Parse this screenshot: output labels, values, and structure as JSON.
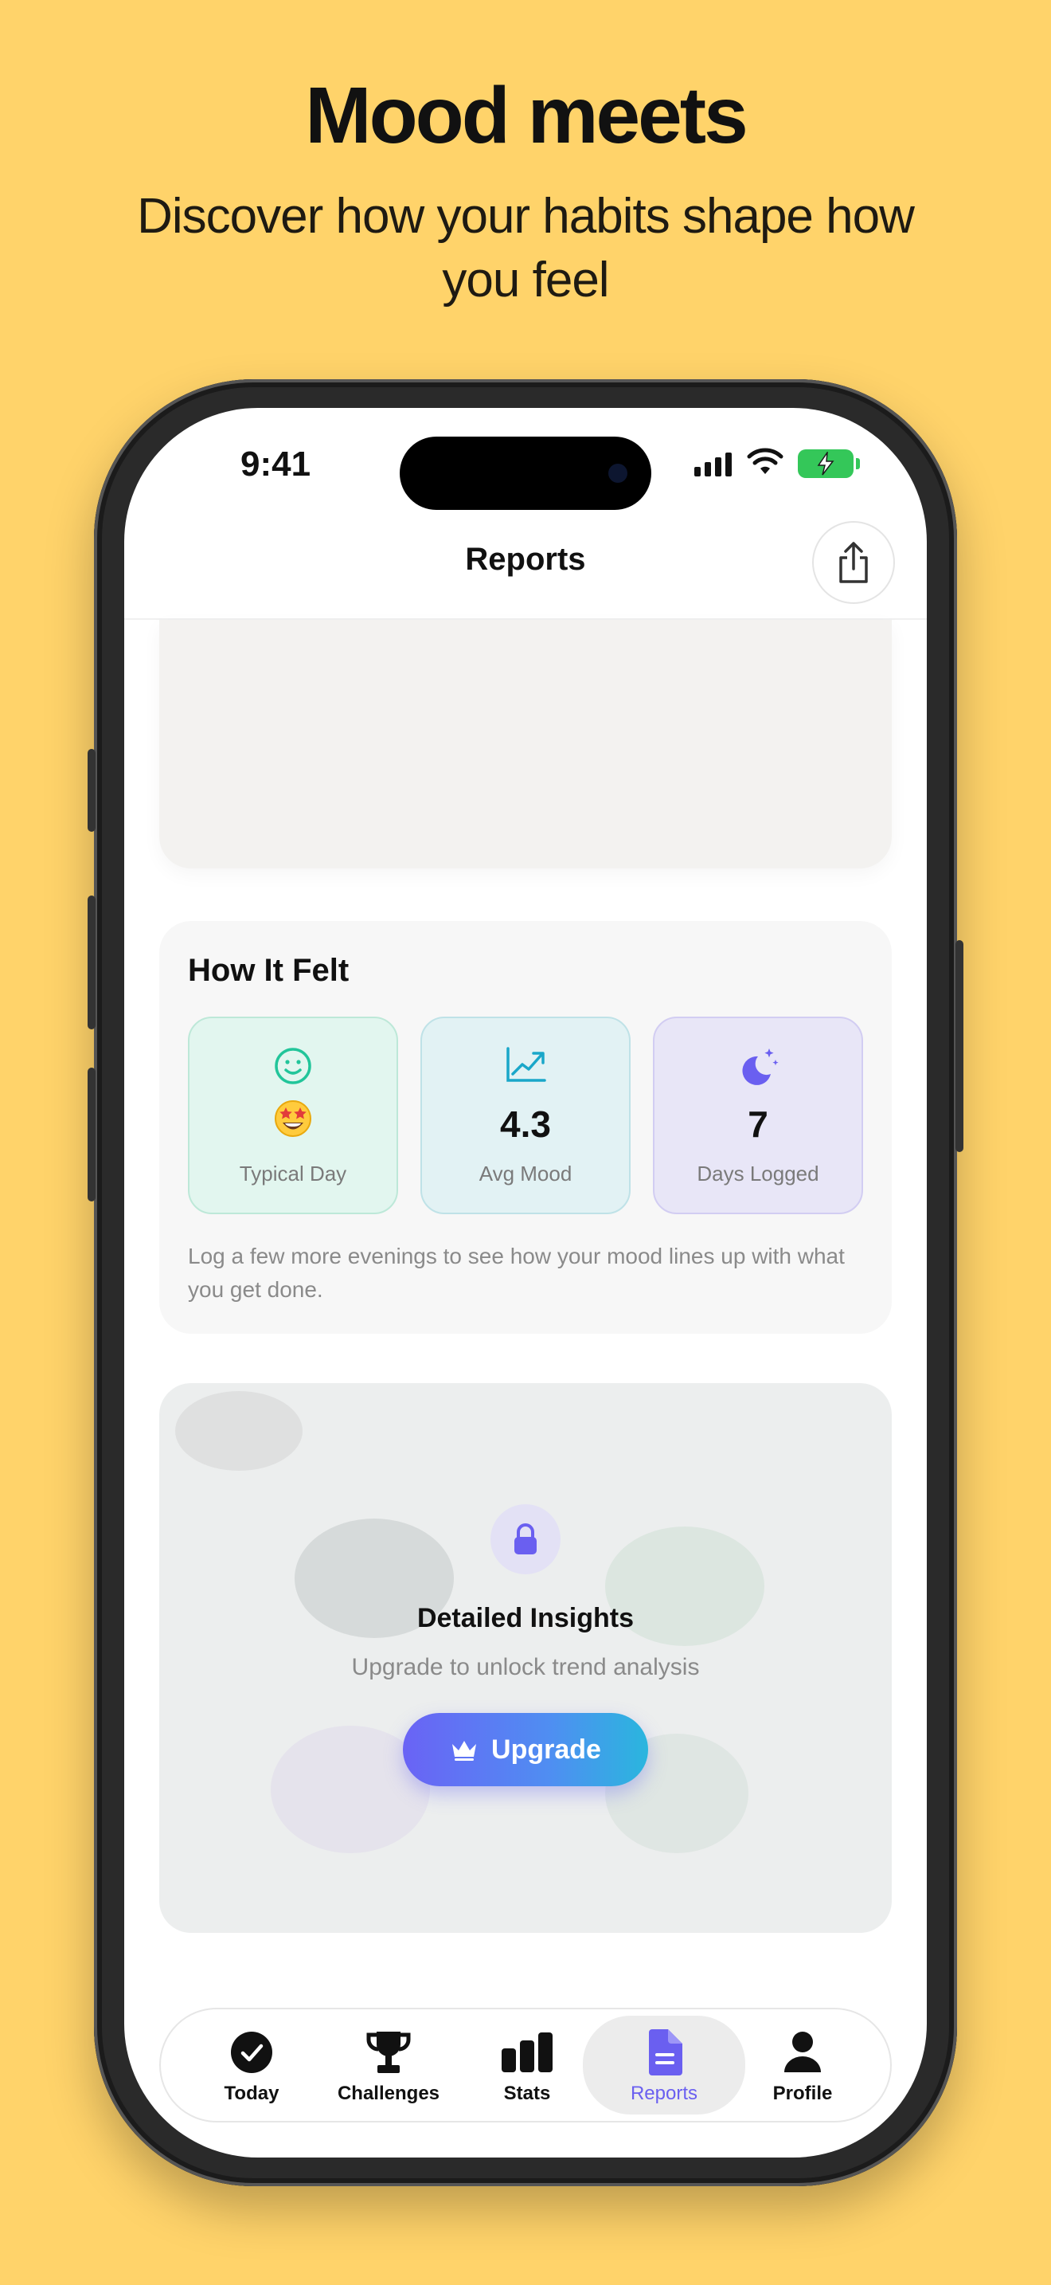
{
  "marketing": {
    "headline": "Mood meets",
    "subline": "Discover how your habits shape how you feel"
  },
  "status_bar": {
    "time": "9:41"
  },
  "nav": {
    "title": "Reports",
    "share_icon": "share-icon"
  },
  "how_it_felt": {
    "title": "How It Felt",
    "tiles": [
      {
        "icon": "smile-icon",
        "emoji": "star-struck-emoji",
        "label": "Typical Day"
      },
      {
        "icon": "chart-trend-icon",
        "value": "4.3",
        "label": "Avg Mood"
      },
      {
        "icon": "moon-stars-icon",
        "value": "7",
        "label": "Days Logged"
      }
    ],
    "note": "Log a few more evenings to see how your mood lines up with what you get done."
  },
  "locked": {
    "icon": "lock-icon",
    "title": "Detailed Insights",
    "subtitle": "Upgrade to unlock trend analysis",
    "button_label": "Upgrade",
    "button_icon": "crown-icon"
  },
  "tabbar": {
    "items": [
      {
        "label": "Today",
        "icon": "check-circle-icon",
        "active": false
      },
      {
        "label": "Challenges",
        "icon": "trophy-icon",
        "active": false
      },
      {
        "label": "Stats",
        "icon": "bar-chart-icon",
        "active": false
      },
      {
        "label": "Reports",
        "icon": "document-icon",
        "active": true
      },
      {
        "label": "Profile",
        "icon": "person-icon",
        "active": false
      }
    ]
  },
  "colors": {
    "background": "#FFD36A",
    "accent": "#6A5FF0",
    "battery": "#34C759"
  }
}
